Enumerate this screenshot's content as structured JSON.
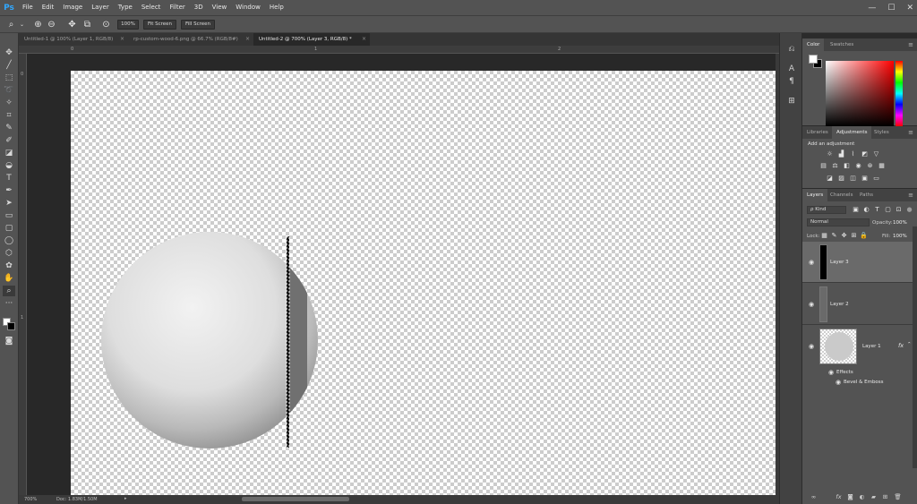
{
  "app": {
    "logo": "Ps"
  },
  "menu": [
    "File",
    "Edit",
    "Image",
    "Layer",
    "Type",
    "Select",
    "Filter",
    "3D",
    "View",
    "Window",
    "Help"
  ],
  "window_controls": {
    "minimize": "—",
    "maximize": "☐",
    "close": "✕"
  },
  "options_bar": {
    "zoom_100": "100%",
    "fit_screen": "Fit Screen",
    "fill_screen": "Fill Screen"
  },
  "tabs": [
    {
      "label": "Untitled-1 @ 100% (Layer 1, RGB/8)",
      "close": "×"
    },
    {
      "label": "rp-custom-wood-6.png @ 66.7% (RGB/8#)",
      "close": "×"
    },
    {
      "label": "Untitled-2 @ 700% (Layer 3, RGB/8) *",
      "close": "×"
    }
  ],
  "ruler": {
    "h_marks": [
      "0",
      "1",
      "2"
    ],
    "v_marks": [
      "0",
      "1"
    ]
  },
  "status": {
    "zoom": "700%",
    "doc": "Doc: 1.83M/1.50M",
    "arrow": "▸"
  },
  "color_panel": {
    "tabs": [
      "Color",
      "Swatches"
    ],
    "foreground": "#ffffff",
    "background": "#000000",
    "colors": {
      "sv_base": "#ff0000",
      "selection_bg": "#6a6a6a"
    }
  },
  "adjustments_panel": {
    "tabs": [
      "Libraries",
      "Adjustments",
      "Styles"
    ],
    "heading": "Add an adjustment"
  },
  "layers_panel": {
    "tabs": [
      "Layers",
      "Channels",
      "Paths"
    ],
    "filter_label": "ρ Kind",
    "blend_mode": "Normal",
    "opacity_label": "Opacity:",
    "opacity_value": "100%",
    "lock_label": "Lock:",
    "fill_label": "Fill:",
    "fill_value": "100%",
    "layers": [
      {
        "name": "Layer 3",
        "selected": true
      },
      {
        "name": "Layer 2",
        "selected": false
      },
      {
        "name": "Layer 1",
        "selected": false,
        "fx": "fx"
      }
    ],
    "effects_label": "Effects",
    "bevel_label": "Bevel & Emboss"
  }
}
